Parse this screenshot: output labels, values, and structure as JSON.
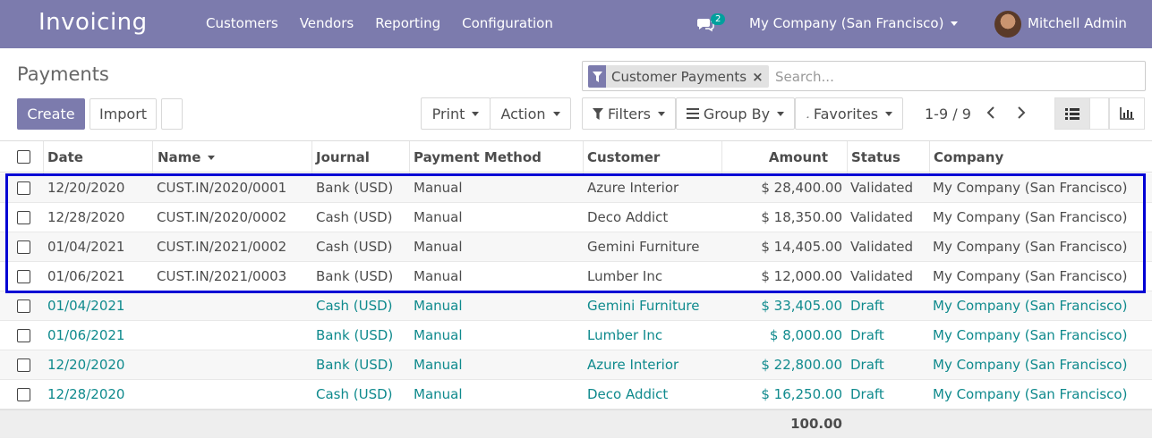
{
  "navbar": {
    "app_title": "Invoicing",
    "menu": [
      "Customers",
      "Vendors",
      "Reporting",
      "Configuration"
    ],
    "chat_badge": "2",
    "company": "My Company (San Francisco)",
    "user": "Mitchell Admin"
  },
  "page": {
    "title": "Payments"
  },
  "search": {
    "facet": "Customer Payments",
    "placeholder": "Search..."
  },
  "buttons": {
    "create": "Create",
    "import": "Import",
    "print": "Print",
    "action": "Action",
    "filters": "Filters",
    "group_by": "Group By",
    "favorites": "Favorites"
  },
  "pager": {
    "value": "1-9 / 9"
  },
  "table": {
    "columns": [
      "Date",
      "Name",
      "Journal",
      "Payment Method",
      "Customer",
      "Amount",
      "Status",
      "Company"
    ],
    "rows": [
      {
        "date": "12/20/2020",
        "name": "CUST.IN/2020/0001",
        "journal": "Bank (USD)",
        "method": "Manual",
        "customer": "Azure Interior",
        "amount": "$ 28,400.00",
        "status": "Validated",
        "company": "My Company (San Francisco)",
        "draft": false
      },
      {
        "date": "12/28/2020",
        "name": "CUST.IN/2020/0002",
        "journal": "Cash (USD)",
        "method": "Manual",
        "customer": "Deco Addict",
        "amount": "$ 18,350.00",
        "status": "Validated",
        "company": "My Company (San Francisco)",
        "draft": false
      },
      {
        "date": "01/04/2021",
        "name": "CUST.IN/2021/0002",
        "journal": "Cash (USD)",
        "method": "Manual",
        "customer": "Gemini Furniture",
        "amount": "$ 14,405.00",
        "status": "Validated",
        "company": "My Company (San Francisco)",
        "draft": false
      },
      {
        "date": "01/06/2021",
        "name": "CUST.IN/2021/0003",
        "journal": "Bank (USD)",
        "method": "Manual",
        "customer": "Lumber Inc",
        "amount": "$ 12,000.00",
        "status": "Validated",
        "company": "My Company (San Francisco)",
        "draft": false
      },
      {
        "date": "01/04/2021",
        "name": "",
        "journal": "Cash (USD)",
        "method": "Manual",
        "customer": "Gemini Furniture",
        "amount": "$ 33,405.00",
        "status": "Draft",
        "company": "My Company (San Francisco)",
        "draft": true
      },
      {
        "date": "01/06/2021",
        "name": "",
        "journal": "Bank (USD)",
        "method": "Manual",
        "customer": "Lumber Inc",
        "amount": "$ 8,000.00",
        "status": "Draft",
        "company": "My Company (San Francisco)",
        "draft": true
      },
      {
        "date": "12/20/2020",
        "name": "",
        "journal": "Bank (USD)",
        "method": "Manual",
        "customer": "Azure Interior",
        "amount": "$ 22,800.00",
        "status": "Draft",
        "company": "My Company (San Francisco)",
        "draft": true
      },
      {
        "date": "12/28/2020",
        "name": "",
        "journal": "Cash (USD)",
        "method": "Manual",
        "customer": "Deco Addict",
        "amount": "$ 16,250.00",
        "status": "Draft",
        "company": "My Company (San Francisco)",
        "draft": true
      }
    ],
    "total": "100.00"
  },
  "colors": {
    "brand": "#7c7bad",
    "draft_text": "#0f8a8d",
    "badge": "#00a09d",
    "highlight": "#0000d4"
  }
}
